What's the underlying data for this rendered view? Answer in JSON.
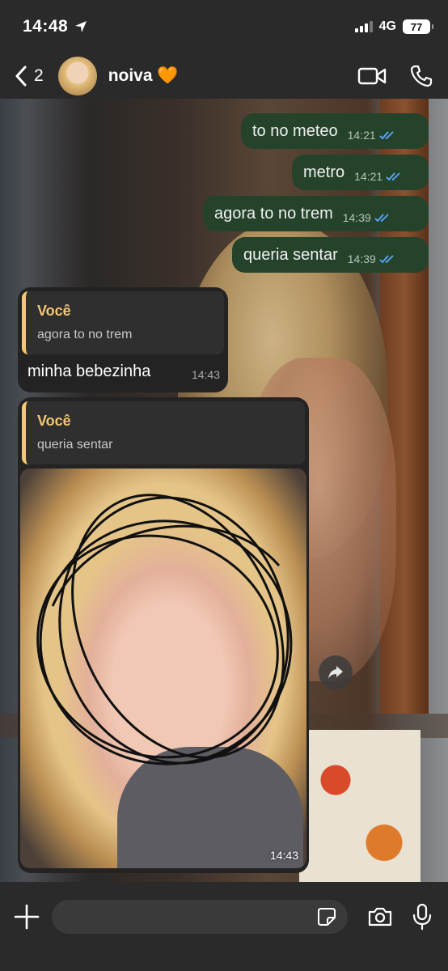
{
  "status_bar": {
    "time": "14:48",
    "network": "4G",
    "battery": "77"
  },
  "header": {
    "back_count": "2",
    "contact_name": "noiva 🧡"
  },
  "messages_out": [
    {
      "text": "to no meteo",
      "time": "14:21"
    },
    {
      "text": "metro",
      "time": "14:21"
    },
    {
      "text": "agora to no trem",
      "time": "14:39"
    },
    {
      "text": "queria sentar",
      "time": "14:39"
    }
  ],
  "reply_1": {
    "quote_author": "Você",
    "quote_text": "agora to no trem",
    "text": "minha bebezinha",
    "time": "14:43"
  },
  "reply_2": {
    "quote_author": "Você",
    "quote_text": "queria sentar",
    "time": "14:43"
  },
  "colors": {
    "outgoing_bubble": "#25432b",
    "incoming_bubble": "#232323",
    "quote_accent": "#f3c774",
    "read_ticks": "#5aa8ff"
  },
  "icons": [
    "location-arrow-icon",
    "back-chevron-icon",
    "video-call-icon",
    "phone-icon",
    "read-ticks-icon",
    "forward-icon",
    "plus-icon",
    "sticker-icon",
    "camera-icon",
    "microphone-icon"
  ]
}
